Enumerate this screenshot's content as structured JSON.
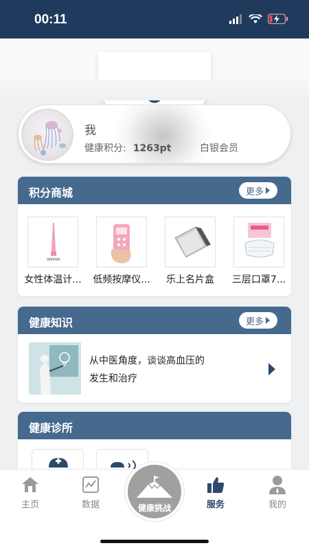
{
  "status_bar": {
    "time": "00:11"
  },
  "header": {
    "service_label": "服务"
  },
  "profile": {
    "name": "我",
    "points_label": "健康积分:",
    "points_value": "1263pt",
    "level": "白银会员"
  },
  "points_mall": {
    "title": "积分商城",
    "more_label": "更多",
    "products": [
      {
        "name": "女性体温计..."
      },
      {
        "name": "低频按摩仪..."
      },
      {
        "name": "乐上名片盒"
      },
      {
        "name": "三层口罩7..."
      }
    ]
  },
  "health_knowledge": {
    "title": "健康知识",
    "more_label": "更多",
    "article": {
      "line1": "从中医角度，谈谈高血压的",
      "line2": "发生和治疗"
    }
  },
  "health_clinic": {
    "title": "健康诊所"
  },
  "tab_bar": {
    "home": "主页",
    "data": "数据",
    "challenge": "健康挑战",
    "service": "服务",
    "mine": "我的"
  },
  "colors": {
    "status_bar": "#1f3a5c",
    "accent": "#46698e",
    "active_tab": "#2d4a6b",
    "challenge_button": "#a0a0a0"
  }
}
